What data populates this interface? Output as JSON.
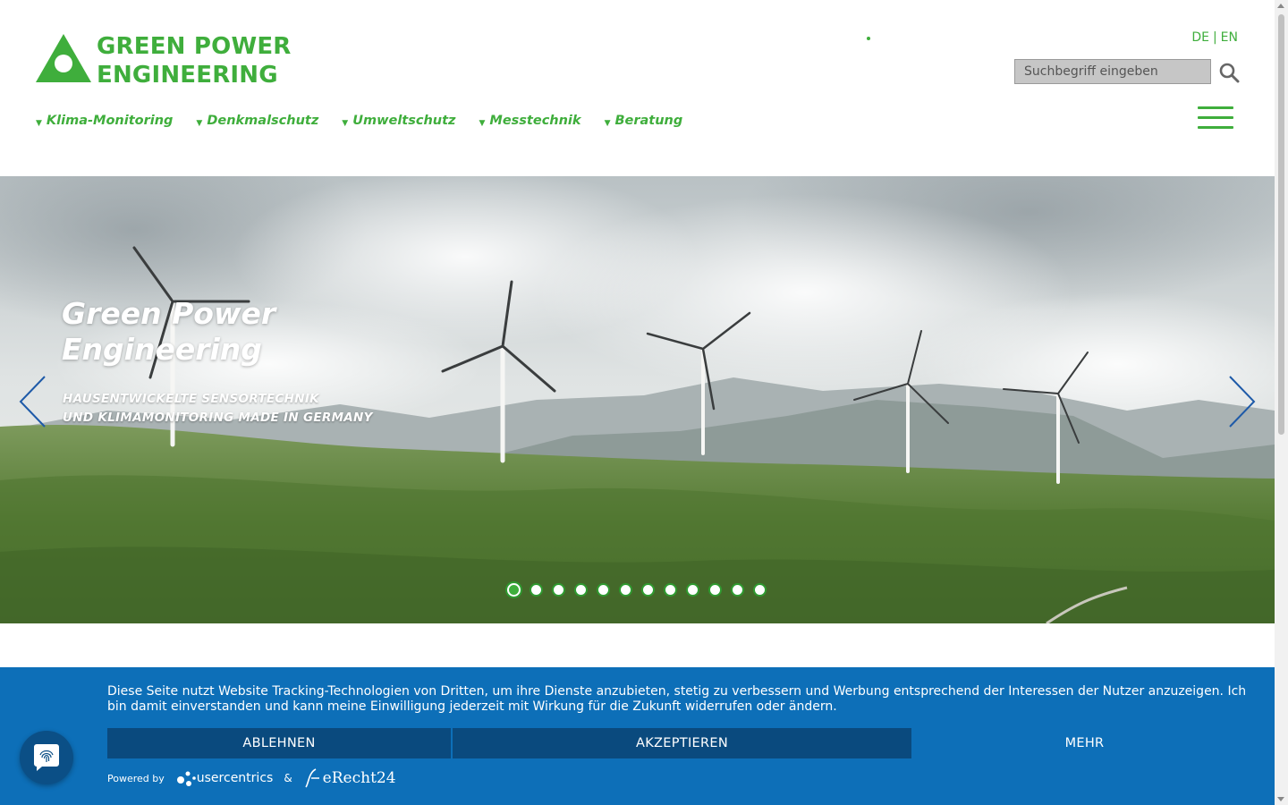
{
  "header": {
    "logo_line1": "GREEN POWER",
    "logo_line2": "ENGINEERING",
    "lang_de": "DE",
    "lang_sep": "|",
    "lang_en": "EN",
    "search_placeholder": "Suchbegriff eingeben",
    "nav": [
      {
        "label": "Klima-Monitoring"
      },
      {
        "label": "Denkmalschutz"
      },
      {
        "label": "Umweltschutz"
      },
      {
        "label": "Messtechnik"
      },
      {
        "label": "Beratung"
      }
    ],
    "nav_caret": "▼"
  },
  "hero": {
    "title_line1": "Green Power",
    "title_line2": "Engineering",
    "subtitle_line1": "HAUSENTWICKELTE SENSORTECHNIK",
    "subtitle_line2": "UND KLIMAMONITORING MADE IN GERMANY",
    "slide_count": 12,
    "active_slide": 1
  },
  "consent": {
    "text": "Diese Seite nutzt Website Tracking-Technologien von Dritten, um ihre Dienste anzubieten, stetig zu verbessern und Werbung entsprechend der Interessen der Nutzer anzuzeigen. Ich bin damit einverstanden und kann meine Einwilligung jederzeit mit Wirkung für die Zukunft widerrufen oder ändern.",
    "reject_label": "ABLEHNEN",
    "accept_label": "AKZEPTIEREN",
    "more_label": "MEHR",
    "powered_by": "Powered by",
    "usercentrics": "usercentrics",
    "amp": "&",
    "erecht": "eRecht24"
  },
  "colors": {
    "brand_green": "#3fae3c",
    "consent_blue": "#0d6fb8",
    "consent_button": "#0a4a7e",
    "arrow_blue": "#1e5aa8"
  },
  "icons": {
    "logo": "triangle-logo-icon",
    "search": "search-icon",
    "menu": "hamburger-menu-icon",
    "prev": "chevron-left-icon",
    "next": "chevron-right-icon",
    "privacy": "fingerprint-icon"
  }
}
